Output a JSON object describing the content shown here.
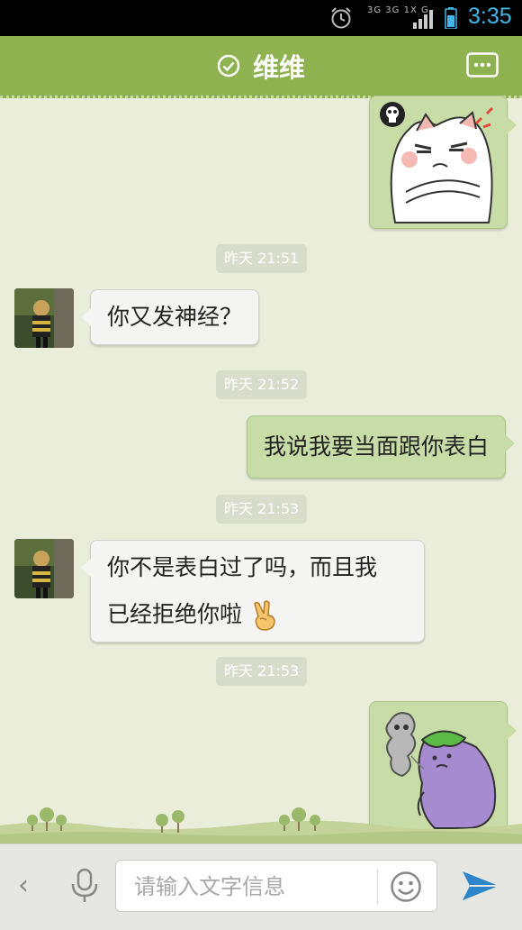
{
  "status_bar": {
    "time": "3:35",
    "network_labels": [
      "3G 3G 1X G"
    ],
    "icons": [
      "alarm-icon",
      "signal-icon",
      "battery-icon"
    ]
  },
  "header": {
    "title": "维维",
    "status_icon": "check-circle-icon",
    "menu_icon": "more-icon"
  },
  "messages": {
    "ts1": "昨天 21:51",
    "ts2": "昨天 21:52",
    "ts3": "昨天 21:53",
    "ts4": "昨天 21:53",
    "msg1": "你又发神经？",
    "msg2": "我说我要当面跟你表白",
    "msg3_line1": "你不是表白过了吗，而且我",
    "msg3_line2": "已经拒绝你啦"
  },
  "input": {
    "placeholder": "请输入文字信息",
    "back_glyph": "‹"
  },
  "colors": {
    "header_bg": "#8eb24f",
    "chat_bg": "#e9edd9",
    "outgoing_bubble": "#c7dca6",
    "incoming_bubble": "#f4f4f2",
    "send_icon": "#2d86c9",
    "clock": "#43b5e8"
  }
}
